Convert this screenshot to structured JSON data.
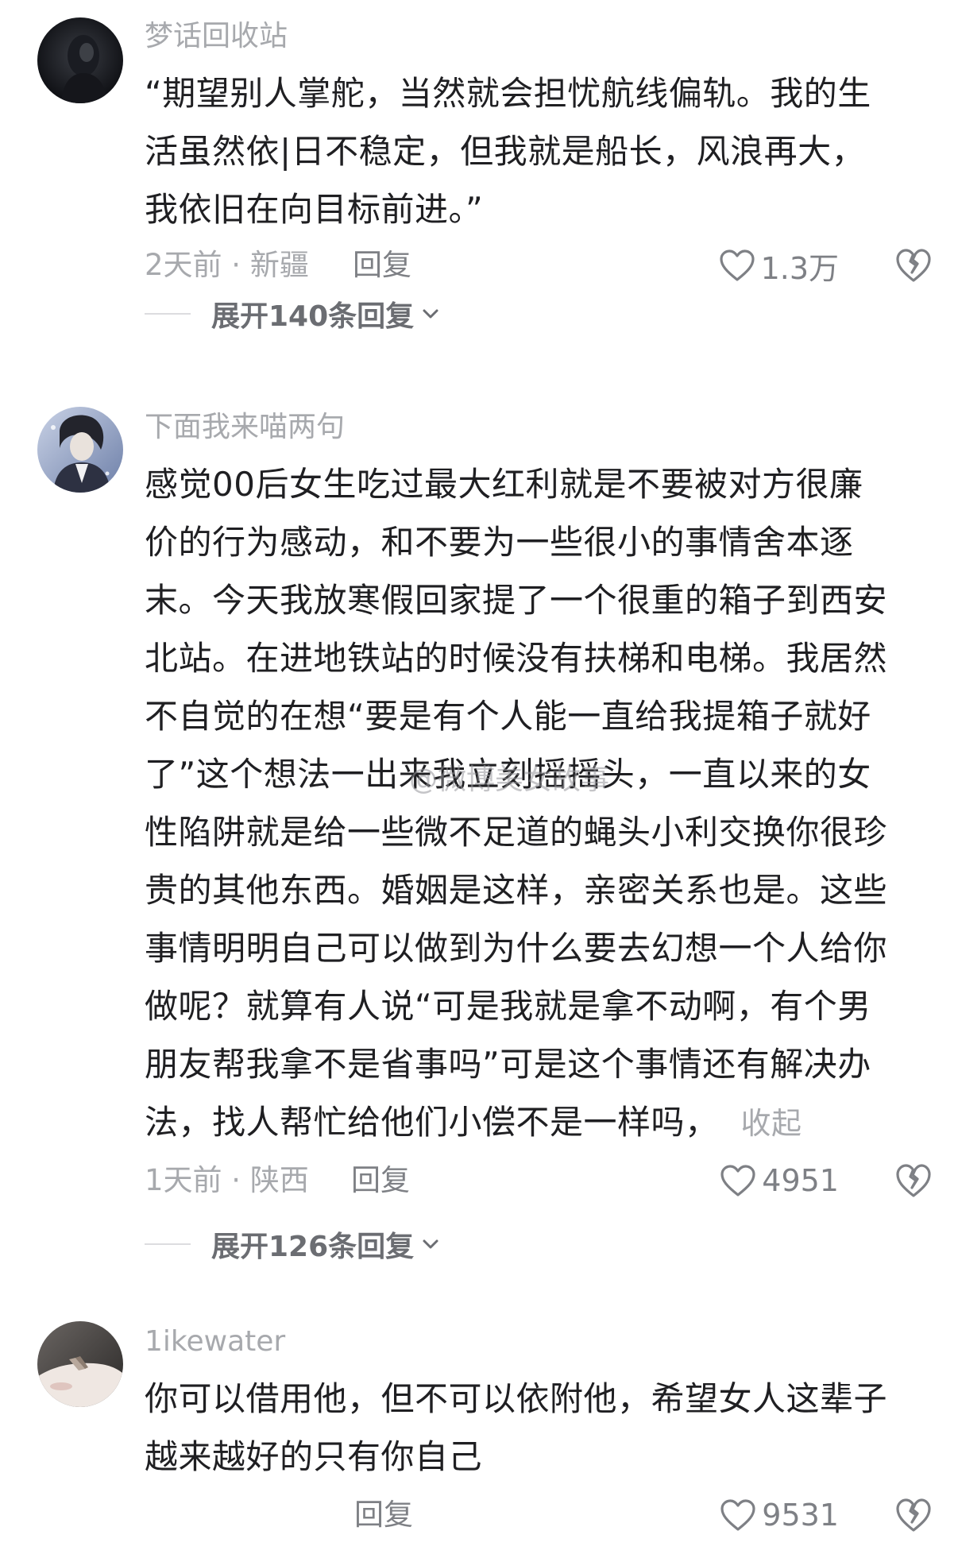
{
  "watermark": "@微博美女故事",
  "comments": [
    {
      "username": "梦话回收站",
      "lines": [
        "“期望别人掌舵，当然就会担忧航线偏轨。我的生",
        "活虽然依|日不稳定，但我就是船长，风浪再大，",
        "我依旧在向目标前进。”"
      ],
      "meta": "2天前 · 新疆",
      "reply_label": "回复",
      "like_count": "1.3万",
      "expand_label": "展开140条回复"
    },
    {
      "username": "下面我来喵两句",
      "lines": [
        "感觉00后女生吃过最大红利就是不要被对方很廉",
        "价的行为感动，和不要为一些很小的事情舍本逐",
        "末。今天我放寒假回家提了一个很重的箱子到西安",
        "北站。在进地铁站的时候没有扶梯和电梯。我居然",
        "不自觉的在想“要是有个人能一直给我提箱子就好",
        "了”这个想法一出来我立刻摇摇头，一直以来的女",
        "性陷阱就是给一些微不足道的蝇头小利交换你很珍",
        "贵的其他东西。婚姻是这样，亲密关系也是。这些",
        "事情明明自己可以做到为什么要去幻想一个人给你",
        "做呢？就算有人说“可是我就是拿不动啊，有个男",
        "朋友帮我拿不是省事吗”可是这个事情还有解决办",
        "法，找人帮忙给他们小偿不是一样吗，"
      ],
      "collapse_label": "收起",
      "meta": "1天前 · 陕西",
      "reply_label": "回复",
      "like_count": "4951",
      "expand_label": "展开126条回复"
    },
    {
      "username": "1ikewater",
      "lines": [
        "你可以借用他，但不可以依附他，希望女人这辈子",
        "越来越好的只有你自己"
      ],
      "meta": "",
      "reply_label": "回复",
      "like_count": "9531"
    }
  ]
}
